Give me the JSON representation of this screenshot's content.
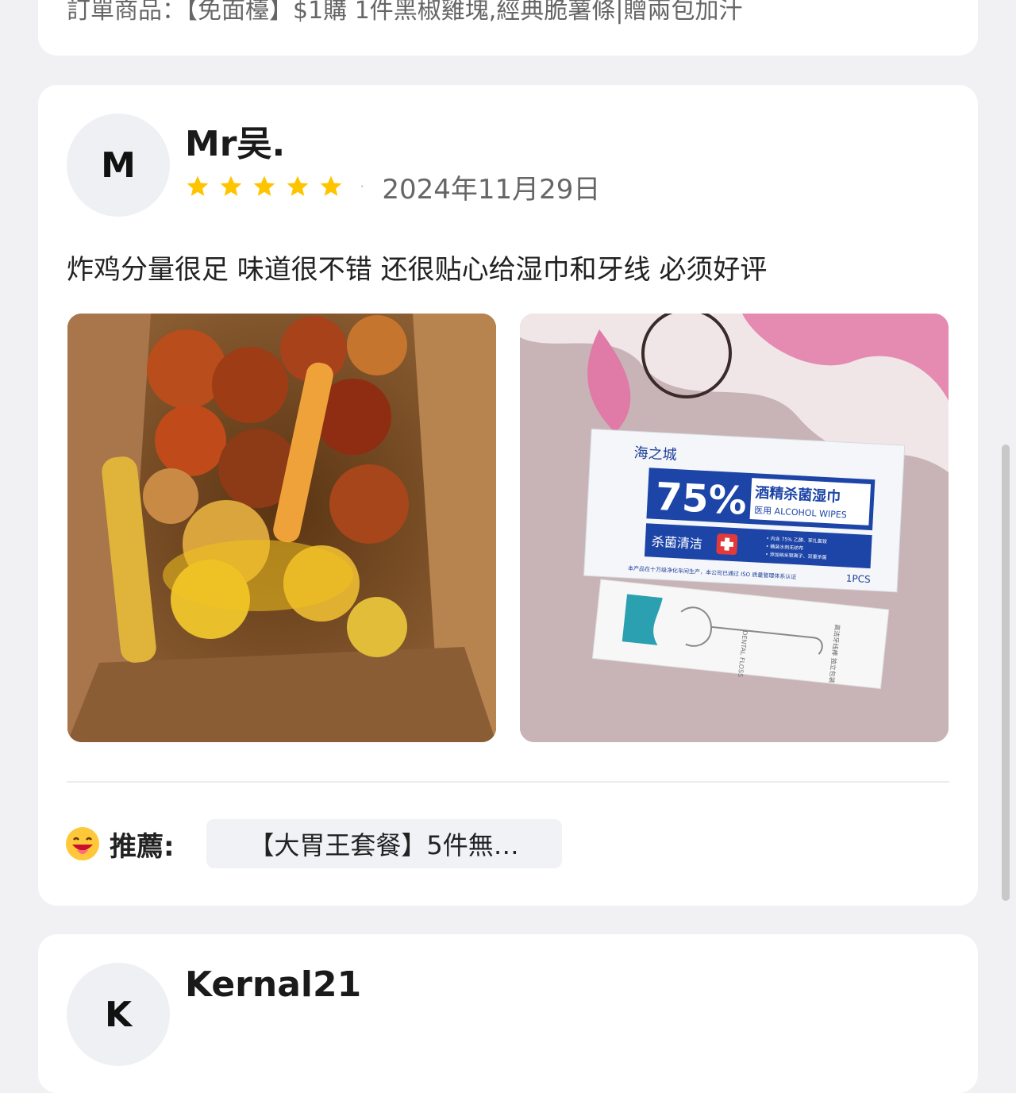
{
  "top_card": {
    "order_line": "訂單商品：【免面檯】$1購 1件黑椒雞塊,經典脆薯條|贈兩包加汁"
  },
  "review": {
    "avatar_letter": "M",
    "username": "Mr吴.",
    "stars": 5,
    "star_color": "#ffc400",
    "date": "2024年11月29日",
    "text": "炸鸡分量很足 味道很不错 还很贴心给湿巾和牙线 必须好评",
    "photo2": {
      "brand": "海之城",
      "percent": "75%",
      "title": "酒精杀菌湿巾",
      "subtitle": "医用 ALCOHOL WIPES",
      "tagline": "杀菌清洁",
      "bullets": [
        "• 内含 75% 乙醇、苯扎氯铵",
        "• 桶装水刺无纺布",
        "• 添加纳米银离子、双重杀菌"
      ],
      "footer": "本产品在十万级净化车间生产，本公司已通过 ISO 质量管理体系认证",
      "pcs": "1PCS",
      "floss_text": "DENTAL FLOSS",
      "floss_cn": "高洁牙线棒 独立包装"
    },
    "recommend_label": "推薦:",
    "recommend_item": "【大胃王套餐】5件無…"
  },
  "next_review": {
    "avatar_letter": "K",
    "username": "Kernal21"
  },
  "colors": {
    "background": "#f1f1f3",
    "card": "#ffffff",
    "chip": "#f0f2f6"
  }
}
